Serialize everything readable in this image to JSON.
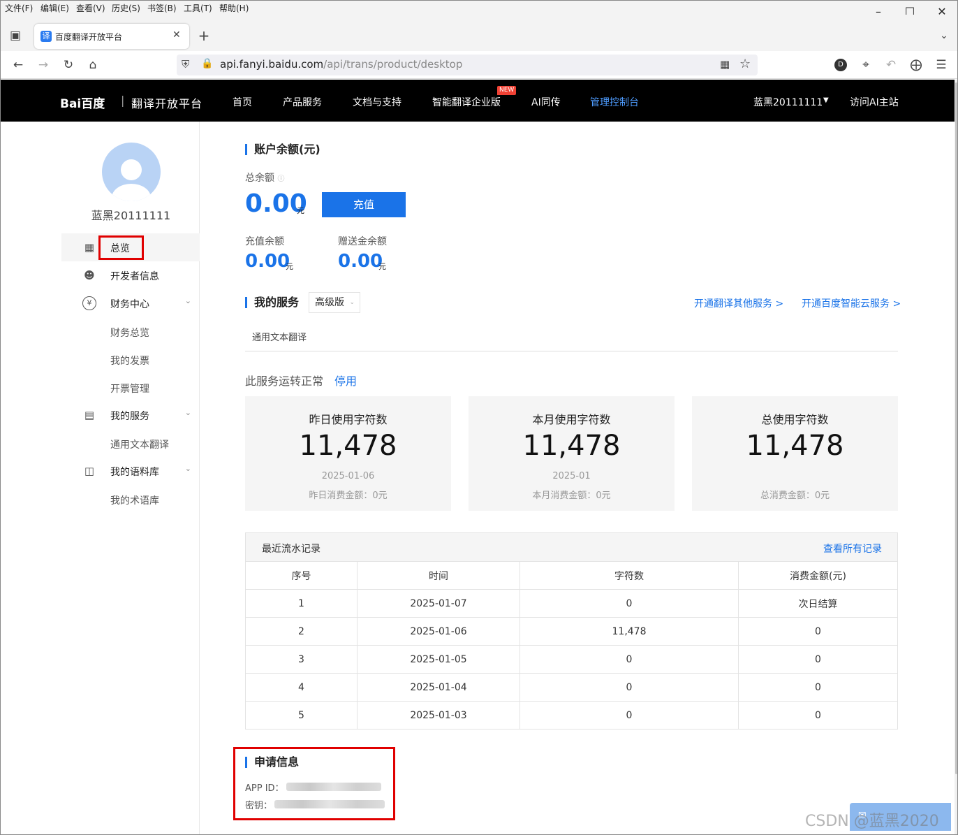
{
  "menubar": {
    "items": [
      "文件(F)",
      "编辑(E)",
      "查看(V)",
      "历史(S)",
      "书签(B)",
      "工具(T)",
      "帮助(H)"
    ]
  },
  "tab": {
    "title": "百度翻译开放平台",
    "favicon": "译"
  },
  "address": {
    "url_host": "api.fanyi.baidu.com",
    "url_path": "/api/trans/product/desktop"
  },
  "header": {
    "logo": "Bai百度",
    "platform": "翻译开放平台",
    "nav": [
      "首页",
      "产品服务",
      "文档与支持",
      "智能翻译企业版",
      "AI同传",
      "管理控制台"
    ],
    "badge": "NEW",
    "user": "蓝黑20111111",
    "visit": "访问AI主站",
    "active_color": "#4e9cff"
  },
  "sidebar": {
    "username": "蓝黑20111111",
    "items": [
      {
        "label": "总览",
        "icon": "grid-icon"
      },
      {
        "label": "开发者信息",
        "icon": "user-icon"
      },
      {
        "label": "财务中心",
        "icon": "yen-icon"
      },
      {
        "label": "我的服务",
        "icon": "document-icon"
      },
      {
        "label": "我的语料库",
        "icon": "box-icon"
      }
    ],
    "subitems": {
      "finance": [
        "财务总览",
        "我的发票",
        "开票管理"
      ],
      "service": [
        "通用文本翻译"
      ],
      "corpus": [
        "我的术语库"
      ]
    }
  },
  "balance": {
    "title": "账户余额(元)",
    "total_label": "总余额",
    "total_value": "0.00",
    "unit": "元",
    "recharge_button": "充值",
    "recharge_label": "充值余额",
    "recharge_value": "0.00",
    "gift_label": "赠送金余额",
    "gift_value": "0.00"
  },
  "services": {
    "title": "我的服务",
    "tier": "高级版",
    "link1": "开通翻译其他服务 >",
    "link2": "开通百度智能云服务 >",
    "tab": "通用文本翻译",
    "status": "此服务运转正常",
    "stop": "停用"
  },
  "stats": [
    {
      "title": "昨日使用字符数",
      "value": "11,478",
      "date": "2025-01-06",
      "cost": "昨日消费金额：0元"
    },
    {
      "title": "本月使用字符数",
      "value": "11,478",
      "date": "2025-01",
      "cost": "本月消费金额：0元"
    },
    {
      "title": "总使用字符数",
      "value": "11,478",
      "date": "",
      "cost": "总消费金额：0元"
    }
  ],
  "records": {
    "title": "最近流水记录",
    "view_all": "查看所有记录",
    "headers": [
      "序号",
      "时间",
      "字符数",
      "消费金额(元)"
    ],
    "rows": [
      [
        "1",
        "2025-01-07",
        "0",
        "次日结算"
      ],
      [
        "2",
        "2025-01-06",
        "11,478",
        "0"
      ],
      [
        "3",
        "2025-01-05",
        "0",
        "0"
      ],
      [
        "4",
        "2025-01-04",
        "0",
        "0"
      ],
      [
        "5",
        "2025-01-03",
        "0",
        "0"
      ]
    ]
  },
  "apply": {
    "title": "申请信息",
    "appid_label": "APP ID：",
    "key_label": "密钥："
  },
  "watermark": "CSDN @蓝黑2020"
}
